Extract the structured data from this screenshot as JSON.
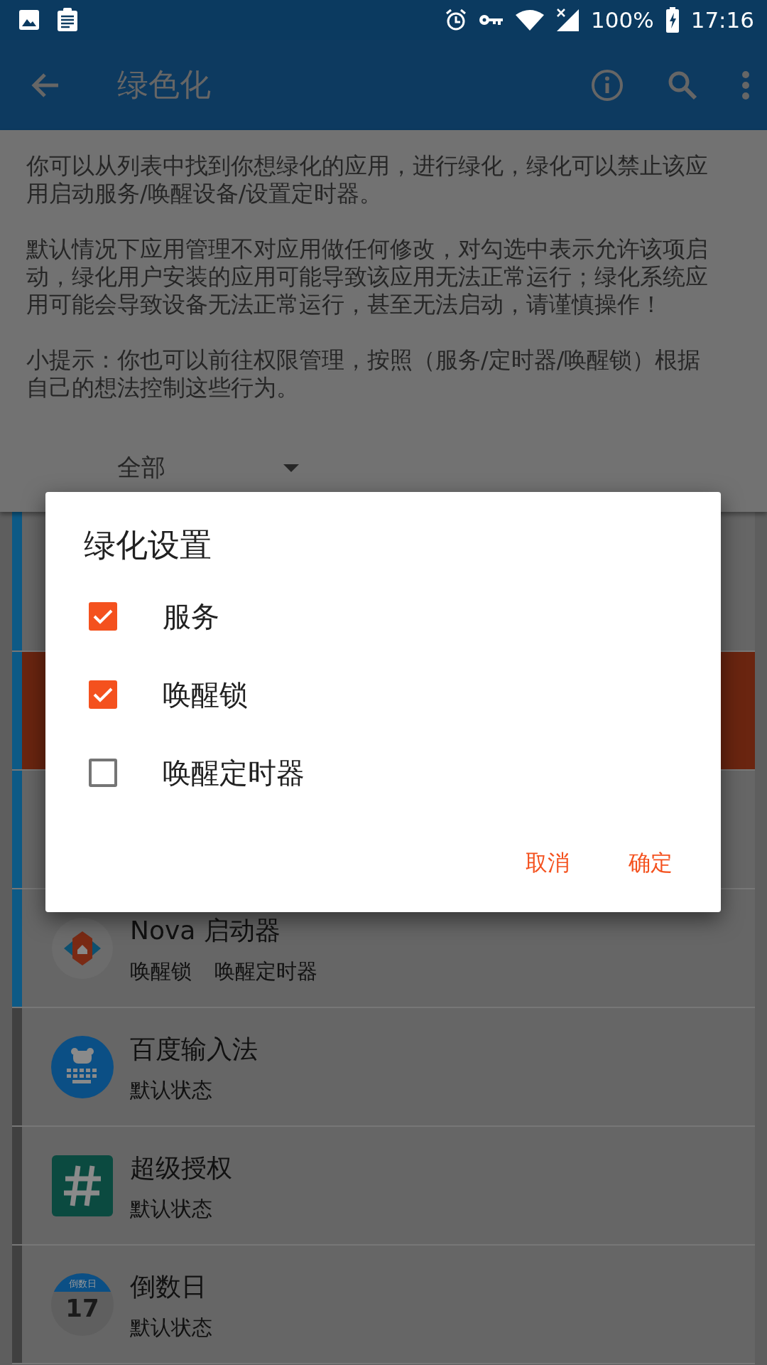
{
  "status_bar": {
    "battery": "100%",
    "time": "17:16"
  },
  "app_bar": {
    "title": "绿色化"
  },
  "description": [
    "你可以从列表中找到你想绿化的应用，进行绿化，绿化可以禁止该应用启动服务/唤醒设备/设置定时器。",
    "默认情况下应用管理不对应用做任何修改，对勾选中表示允许该项启动，绿化用户安装的应用可能导致该应用无法正常运行；绿化系统应用可能会导致设备无法正常运行，甚至无法启动，请谨慎操作！",
    "小提示：你也可以前往权限管理，按照（服务/定时器/唤醒锁）根据自己的想法控制这些行为。"
  ],
  "filter": {
    "value": "全部"
  },
  "apps": [
    {
      "kind": "hidden",
      "color": "#0d5a86"
    },
    {
      "kind": "highlighted",
      "color": "#0d5a86"
    },
    {
      "kind": "hidden",
      "color": "#0d5a86"
    },
    {
      "kind": "app",
      "color": "#0d5a86",
      "name": "Nova 启动器",
      "tags": [
        "唤醒锁",
        "唤醒定时器"
      ]
    },
    {
      "kind": "app",
      "color": "#404040",
      "name": "百度输入法",
      "tags": [
        "默认状态"
      ]
    },
    {
      "kind": "app",
      "color": "#404040",
      "name": "超级授权",
      "tags": [
        "默认状态"
      ]
    },
    {
      "kind": "app",
      "color": "#404040",
      "name": "倒数日",
      "tags": [
        "默认状态"
      ],
      "icon_caption": "倒数日",
      "icon_number": "17"
    }
  ],
  "dialog": {
    "title": "绿化设置",
    "options": [
      {
        "label": "服务",
        "checked": true
      },
      {
        "label": "唤醒锁",
        "checked": true
      },
      {
        "label": "唤醒定时器",
        "checked": false
      }
    ],
    "buttons": [
      "取消",
      "确定"
    ]
  }
}
